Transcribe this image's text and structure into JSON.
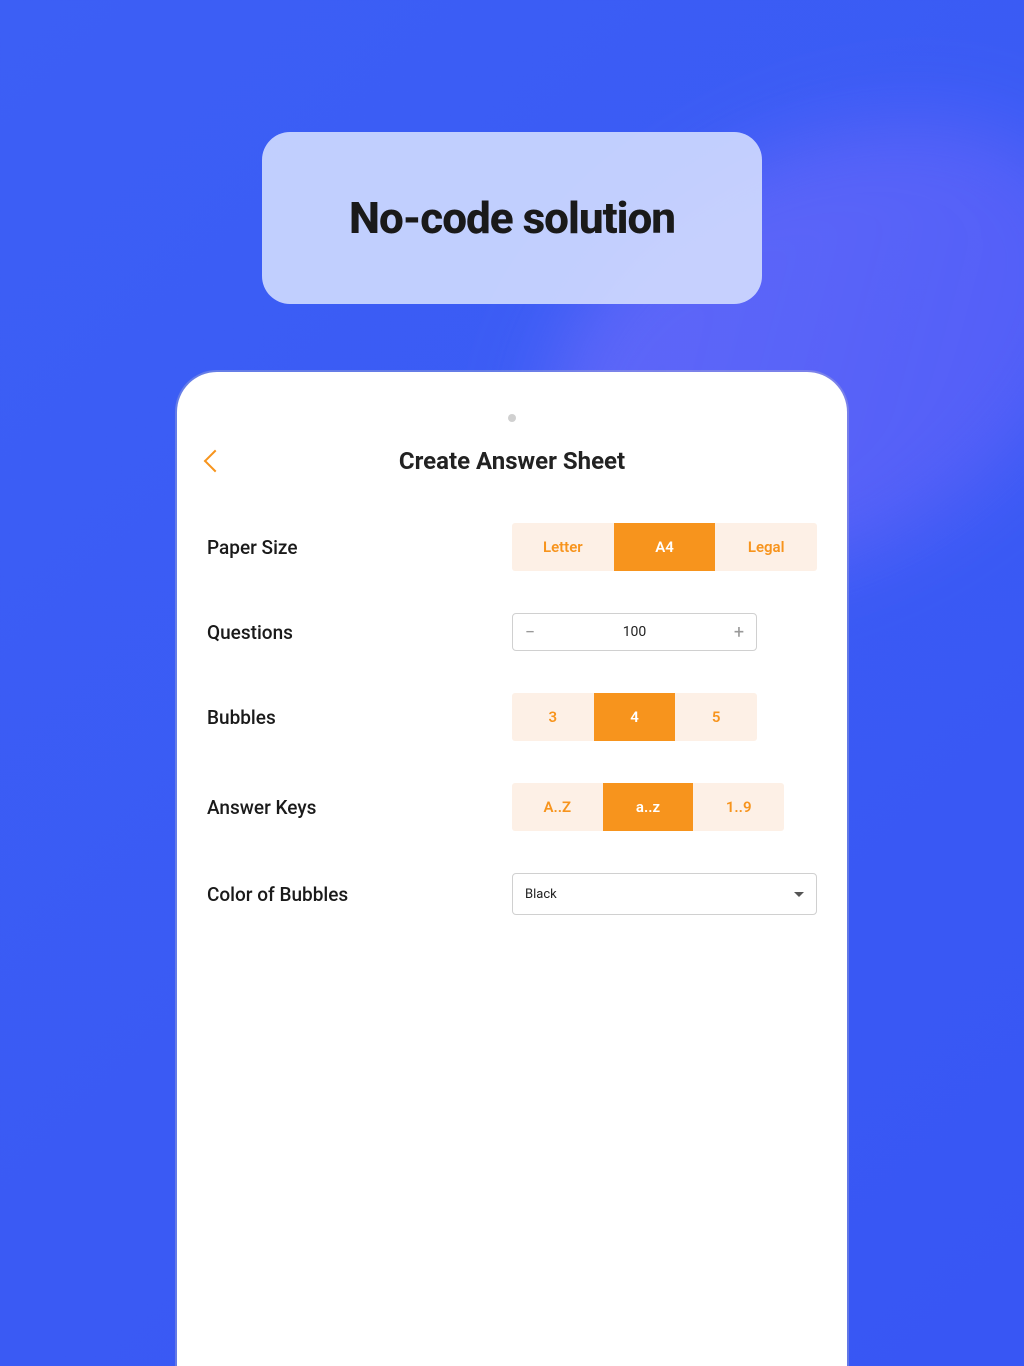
{
  "hero": {
    "title": "No-code solution"
  },
  "screen": {
    "title": "Create Answer Sheet",
    "rows": {
      "paper_size": {
        "label": "Paper Size",
        "options": [
          "Letter",
          "A4",
          "Legal"
        ],
        "selected": "A4"
      },
      "questions": {
        "label": "Questions",
        "value": "100",
        "decrement": "−",
        "increment": "+"
      },
      "bubbles": {
        "label": "Bubbles",
        "options": [
          "3",
          "4",
          "5"
        ],
        "selected": "4"
      },
      "answer_keys": {
        "label": "Answer Keys",
        "options": [
          "A..Z",
          "a..z",
          "1..9"
        ],
        "selected": "a..z"
      },
      "color": {
        "label": "Color of Bubbles",
        "selected": "Black"
      }
    }
  }
}
